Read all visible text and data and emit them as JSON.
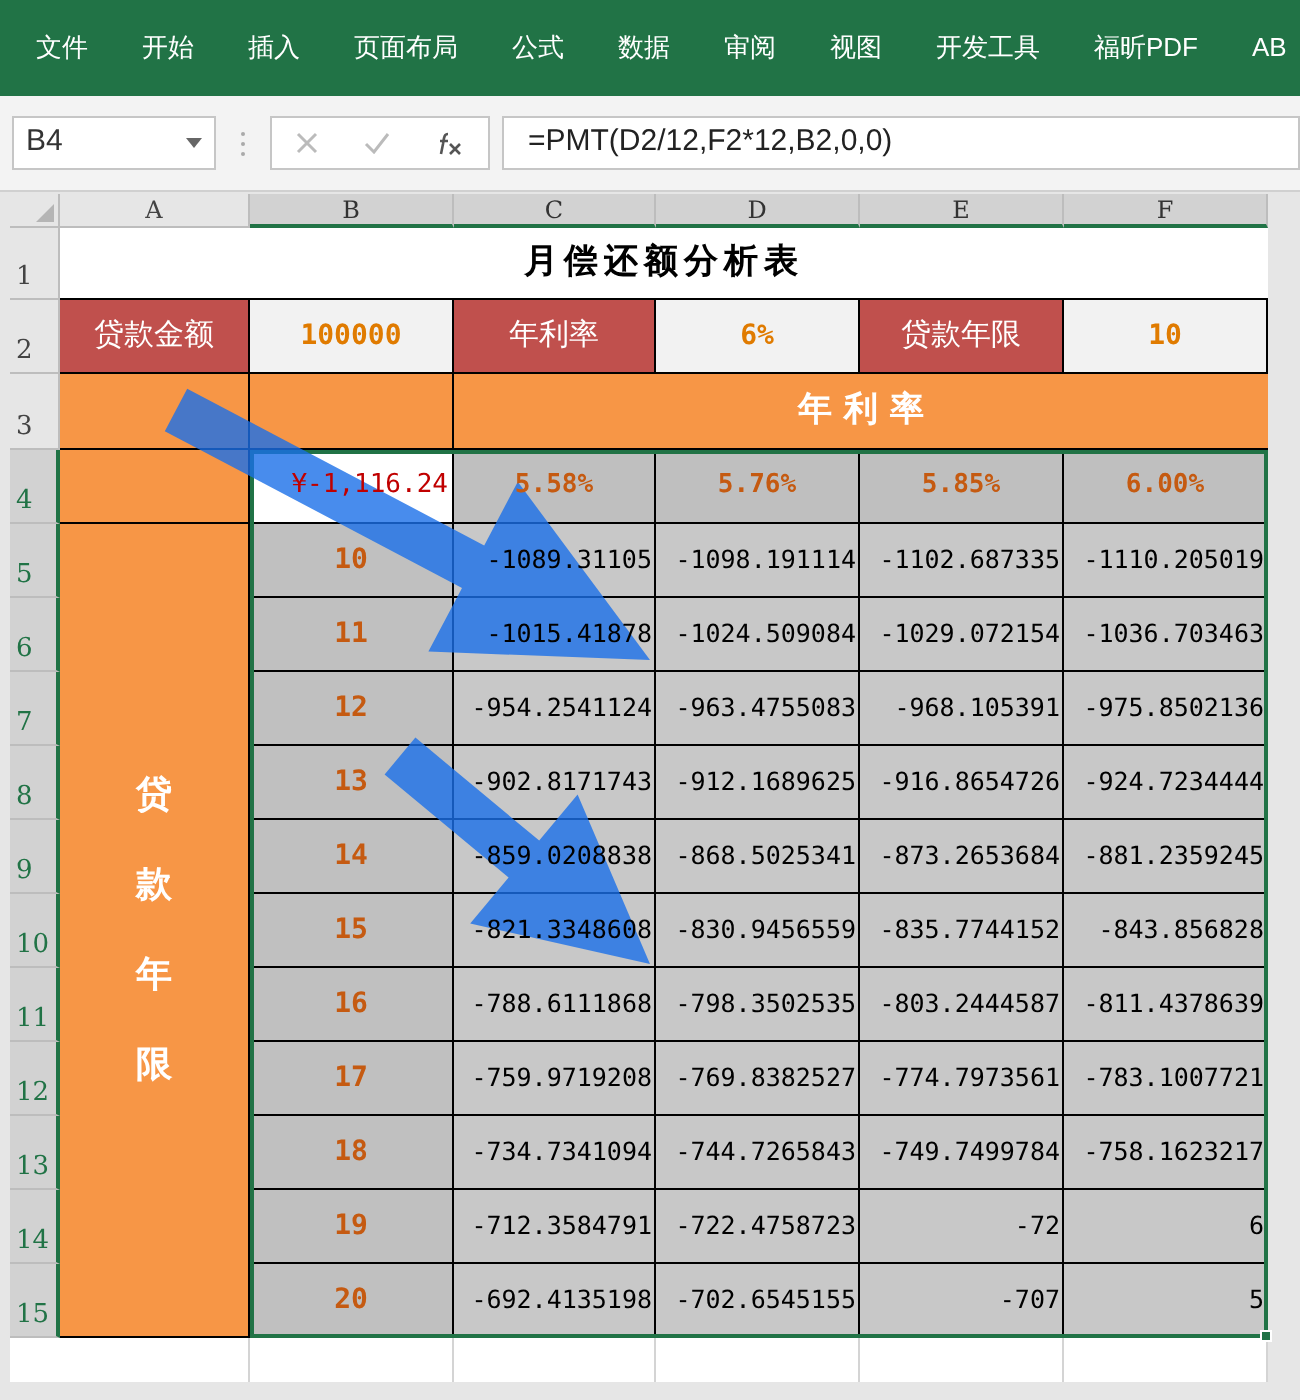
{
  "ribbon_tabs": [
    "文件",
    "开始",
    "插入",
    "页面布局",
    "公式",
    "数据",
    "审阅",
    "视图",
    "开发工具",
    "福昕PDF",
    "AB"
  ],
  "name_box": "B4",
  "formula": "=PMT(D2/12,F2*12,B2,0,0)",
  "columns": [
    {
      "label": "A",
      "selected": false
    },
    {
      "label": "B",
      "selected": true
    },
    {
      "label": "C",
      "selected": true
    },
    {
      "label": "D",
      "selected": true
    },
    {
      "label": "E",
      "selected": true
    },
    {
      "label": "F",
      "selected": true
    }
  ],
  "row_numbers": [
    {
      "label": "1",
      "selected": false
    },
    {
      "label": "2",
      "selected": false
    },
    {
      "label": "3",
      "selected": false
    },
    {
      "label": "4",
      "selected": true
    },
    {
      "label": "5",
      "selected": true
    },
    {
      "label": "6",
      "selected": true
    },
    {
      "label": "7",
      "selected": true
    },
    {
      "label": "8",
      "selected": true
    },
    {
      "label": "9",
      "selected": true
    },
    {
      "label": "10",
      "selected": true
    },
    {
      "label": "11",
      "selected": true
    },
    {
      "label": "12",
      "selected": true
    },
    {
      "label": "13",
      "selected": true
    },
    {
      "label": "14",
      "selected": true
    },
    {
      "label": "15",
      "selected": true
    }
  ],
  "sheet": {
    "title": "月偿还额分析表",
    "params": [
      {
        "label": "贷款金额",
        "value": "100000"
      },
      {
        "label": "年利率",
        "value": "6%"
      },
      {
        "label": "贷款年限",
        "value": "10"
      }
    ],
    "rate_header": "年 利 率",
    "active_cell": "¥-1,116.24",
    "rates": [
      "5.58%",
      "5.76%",
      "5.85%",
      "6.00%"
    ],
    "years_label": "贷款年限",
    "rows": [
      {
        "years": "10",
        "values": [
          "-1089.31105",
          "-1098.191114",
          "-1102.687335",
          "-1110.205019"
        ]
      },
      {
        "years": "11",
        "values": [
          "-1015.41878",
          "-1024.509084",
          "-1029.072154",
          "-1036.703463"
        ]
      },
      {
        "years": "12",
        "values": [
          "-954.2541124",
          "-963.4755083",
          "-968.105391",
          "-975.8502136"
        ]
      },
      {
        "years": "13",
        "values": [
          "-902.8171743",
          "-912.1689625",
          "-916.8654726",
          "-924.7234444"
        ]
      },
      {
        "years": "14",
        "values": [
          "-859.0208838",
          "-868.5025341",
          "-873.2653684",
          "-881.2359245"
        ]
      },
      {
        "years": "15",
        "values": [
          "-821.3348608",
          "-830.9456559",
          "-835.7744152",
          "-843.856828"
        ]
      },
      {
        "years": "16",
        "values": [
          "-788.6111868",
          "-798.3502535",
          "-803.2444587",
          "-811.4378639"
        ]
      },
      {
        "years": "17",
        "values": [
          "-759.9719208",
          "-769.8382527",
          "-774.7973561",
          "-783.1007721"
        ]
      },
      {
        "years": "18",
        "values": [
          "-734.7341094",
          "-744.7265843",
          "-749.7499784",
          "-758.1623217"
        ]
      },
      {
        "years": "19",
        "values": [
          "-712.3584791",
          "-722.4758723",
          "-72",
          "6"
        ]
      },
      {
        "years": "20",
        "values": [
          "-692.4135198",
          "-702.6545155",
          "-707",
          "5"
        ]
      }
    ]
  }
}
